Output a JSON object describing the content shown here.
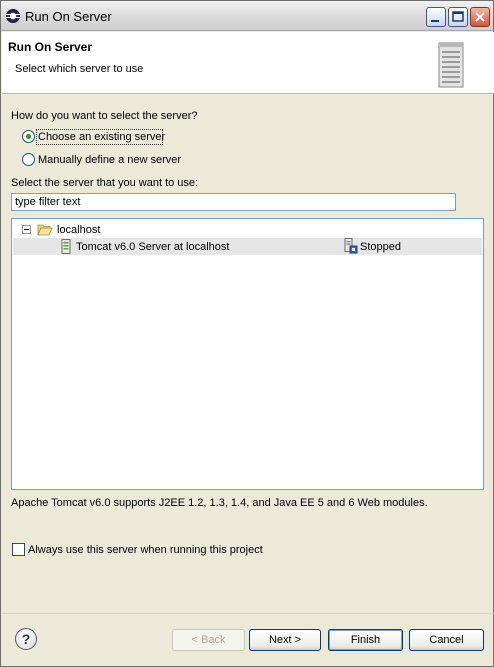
{
  "window": {
    "title": "Run On Server"
  },
  "header": {
    "title": "Run On Server",
    "subtitle": "Select which server to use"
  },
  "selection": {
    "question": "How do you want to select the server?",
    "options": [
      {
        "label": "Choose an existing server",
        "selected": true
      },
      {
        "label": "Manually define a new server",
        "selected": false
      }
    ],
    "list_label": "Select the server that you want to use:"
  },
  "filter": {
    "value": "type filter text"
  },
  "tree": {
    "host": {
      "label": "localhost",
      "expanded": true
    },
    "servers": [
      {
        "name": "Tomcat v6.0 Server at localhost",
        "state": "Stopped",
        "selected": true
      }
    ]
  },
  "description": "Apache Tomcat v6.0 supports J2EE 1.2, 1.3, 1.4, and Java EE 5 and 6 Web modules.",
  "always_use": {
    "label": "Always use this server when running this project",
    "checked": false
  },
  "buttons": {
    "back": "< Back",
    "next": "Next >",
    "finish": "Finish",
    "cancel": "Cancel",
    "help_glyph": "?"
  },
  "colors": {
    "dialog_bg": "#ECE9D8",
    "accent": "#003C74",
    "radio_dot": "#21A121"
  }
}
